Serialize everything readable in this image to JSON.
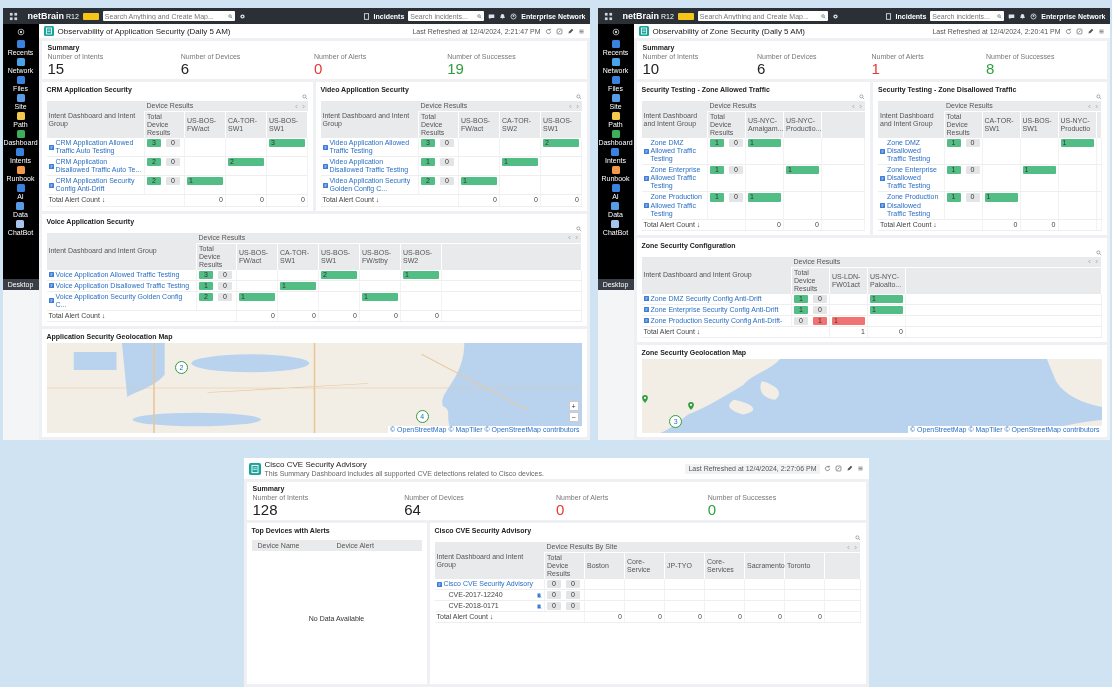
{
  "screens": [
    {
      "topbar": {
        "logo": "netBrain",
        "version": "R12",
        "search_placeholder": "Search Anything and Create Map...",
        "incidents_label": "Incidents",
        "incidents_placeholder": "Search incidents...",
        "network": "Enterprise Network"
      },
      "sidebar": {
        "items": [
          {
            "label": "Recents",
            "color": "#3b82e0"
          },
          {
            "label": "Network",
            "color": "#4aa3e8"
          },
          {
            "label": "Files",
            "color": "#3b82e0"
          },
          {
            "label": "Site",
            "color": "#5a9be6"
          },
          {
            "label": "Path",
            "color": "#f2c94c"
          },
          {
            "label": "Dashboard",
            "color": "#3fae5a"
          },
          {
            "label": "Intents",
            "color": "#3b82e0"
          },
          {
            "label": "Runbook",
            "color": "#f29a4a"
          },
          {
            "label": "AI",
            "color": "#3b82e0"
          },
          {
            "label": "Data",
            "color": "#5a9be6"
          },
          {
            "label": "ChatBot",
            "color": "#a9c4ea"
          }
        ],
        "footer": "Desktop"
      },
      "dashboard": {
        "title": "Observability of Application Security (Daily 5 AM)",
        "refreshed": "Last Refreshed at 12/4/2024, 2:21:47 PM",
        "summary": {
          "title": "Summary",
          "stats": [
            {
              "label": "Number of Intents",
              "value": "15",
              "color": "#222222"
            },
            {
              "label": "Number of Devices",
              "value": "6",
              "color": "#222222"
            },
            {
              "label": "Number of Alerts",
              "value": "0",
              "color": "#e53935"
            },
            {
              "label": "Number of Successes",
              "value": "19",
              "color": "#2e9e3e"
            }
          ]
        },
        "widget_rows": [
          {
            "widgets": [
              {
                "kind": "table",
                "title": "CRM Application Security",
                "group_header": "Intent Dashboard and Intent Group",
                "results_header": "Device Results",
                "total_header": "Total Device Results",
                "columns": [
                  "US-BOS-FW/act",
                  "CA-TOR-SW1",
                  "US-BOS-SW1"
                ],
                "rows": [
                  {
                    "name": "CRM Application Allowed Traffic Auto Testing",
                    "results": [
                      {
                        "value": "3",
                        "color": "#52bd84"
                      },
                      {
                        "value": "0",
                        "color": "#e3e4e6"
                      }
                    ],
                    "cells": [
                      null,
                      null,
                      {
                        "value": "3",
                        "color": "#52bd84"
                      }
                    ]
                  },
                  {
                    "name": "CRM Application Disallowed Traffic Auto Te...",
                    "results": [
                      {
                        "value": "2",
                        "color": "#52bd84"
                      },
                      {
                        "value": "0",
                        "color": "#e3e4e6"
                      }
                    ],
                    "cells": [
                      null,
                      {
                        "value": "2",
                        "color": "#52bd84"
                      },
                      null
                    ]
                  },
                  {
                    "name": "CRM Application Security Config Anti-Drift",
                    "results": [
                      {
                        "value": "2",
                        "color": "#52bd84"
                      },
                      {
                        "value": "0",
                        "color": "#e3e4e6"
                      }
                    ],
                    "cells": [
                      {
                        "value": "1",
                        "color": "#52bd84"
                      },
                      null,
                      null
                    ]
                  }
                ],
                "total_label": "Total Alert Count ↓",
                "totals": [
                  "0",
                  "0",
                  "0"
                ]
              },
              {
                "kind": "table",
                "title": "Video Application Security",
                "group_header": "Intent Dashboard and Intent Group",
                "results_header": "Device Results",
                "total_header": "Total Device Results",
                "columns": [
                  "US-BOS-FW/act",
                  "CA-TOR-SW2",
                  "US-BOS-SW1"
                ],
                "rows": [
                  {
                    "name": "Video Application Allowed Traffic Testing",
                    "results": [
                      {
                        "value": "3",
                        "color": "#52bd84"
                      },
                      {
                        "value": "0",
                        "color": "#e3e4e6"
                      }
                    ],
                    "cells": [
                      null,
                      null,
                      {
                        "value": "2",
                        "color": "#52bd84"
                      }
                    ]
                  },
                  {
                    "name": "Video Application Disallowed Traffic Testing",
                    "results": [
                      {
                        "value": "1",
                        "color": "#52bd84"
                      },
                      {
                        "value": "0",
                        "color": "#e3e4e6"
                      }
                    ],
                    "cells": [
                      null,
                      {
                        "value": "1",
                        "color": "#52bd84"
                      },
                      null
                    ]
                  },
                  {
                    "name": "Video Application Security Golden Config C...",
                    "results": [
                      {
                        "value": "2",
                        "color": "#52bd84"
                      },
                      {
                        "value": "0",
                        "color": "#e3e4e6"
                      }
                    ],
                    "cells": [
                      {
                        "value": "1",
                        "color": "#52bd84"
                      },
                      null,
                      null
                    ]
                  }
                ],
                "total_label": "Total Alert Count ↓",
                "totals": [
                  "0",
                  "0",
                  "0"
                ]
              }
            ]
          },
          {
            "widgets": [
              {
                "kind": "table",
                "title": "Voice Application Security",
                "group_header": "Intent Dashboard and Intent Group",
                "results_header": "Device Results",
                "total_header": "Total Device Results",
                "columns": [
                  "US-BOS-FW/act",
                  "CA-TOR-SW1",
                  "US-BOS-SW1",
                  "US-BOS-FW/stby",
                  "US-BOS-SW2"
                ],
                "rows": [
                  {
                    "name": "Voice Application Allowed Traffic Testing",
                    "results": [
                      {
                        "value": "3",
                        "color": "#52bd84"
                      },
                      {
                        "value": "0",
                        "color": "#e3e4e6"
                      }
                    ],
                    "cells": [
                      null,
                      null,
                      {
                        "value": "2",
                        "color": "#52bd84"
                      },
                      null,
                      {
                        "value": "1",
                        "color": "#52bd84"
                      }
                    ]
                  },
                  {
                    "name": "Voice Application Disallowed Traffic Testing",
                    "results": [
                      {
                        "value": "1",
                        "color": "#52bd84"
                      },
                      {
                        "value": "0",
                        "color": "#e3e4e6"
                      }
                    ],
                    "cells": [
                      null,
                      {
                        "value": "1",
                        "color": "#52bd84"
                      },
                      null,
                      null,
                      null
                    ]
                  },
                  {
                    "name": "Voice Application Security Golden Config C...",
                    "results": [
                      {
                        "value": "2",
                        "color": "#52bd84"
                      },
                      {
                        "value": "0",
                        "color": "#e3e4e6"
                      }
                    ],
                    "cells": [
                      {
                        "value": "1",
                        "color": "#52bd84"
                      },
                      null,
                      null,
                      {
                        "value": "1",
                        "color": "#52bd84"
                      },
                      null
                    ]
                  }
                ],
                "total_label": "Total Alert Count ↓",
                "totals": [
                  "0",
                  "0",
                  "0",
                  "0",
                  "0"
                ]
              }
            ]
          },
          {
            "widgets": [
              {
                "kind": "lake_map",
                "title": "Application Security Geolocation Map",
                "markers": [
                  {
                    "kind": "cluster",
                    "count": "2"
                  },
                  {
                    "kind": "cluster",
                    "count": "4"
                  }
                ],
                "zoom_controls": [
                  "+",
                  "−"
                ],
                "attribution": "© OpenStreetMap © MapTiler © OpenStreetMap contributors"
              }
            ]
          }
        ]
      }
    },
    {
      "topbar": {
        "logo": "netBrain",
        "version": "R12",
        "search_placeholder": "Search Anything and Create Map...",
        "incidents_label": "Incidents",
        "incidents_placeholder": "Search incidents...",
        "network": "Enterprise Network"
      },
      "sidebar": {
        "items": [
          {
            "label": "Recents",
            "color": "#3b82e0"
          },
          {
            "label": "Network",
            "color": "#4aa3e8"
          },
          {
            "label": "Files",
            "color": "#3b82e0"
          },
          {
            "label": "Site",
            "color": "#5a9be6"
          },
          {
            "label": "Path",
            "color": "#f2c94c"
          },
          {
            "label": "Dashboard",
            "color": "#3fae5a"
          },
          {
            "label": "Intents",
            "color": "#3b82e0"
          },
          {
            "label": "Runbook",
            "color": "#f29a4a"
          },
          {
            "label": "AI",
            "color": "#3b82e0"
          },
          {
            "label": "Data",
            "color": "#5a9be6"
          },
          {
            "label": "ChatBot",
            "color": "#a9c4ea"
          }
        ],
        "footer": "Desktop"
      },
      "dashboard": {
        "title": "Observability of Zone Security (Daily 5 AM)",
        "refreshed": "Last Refreshed at 12/4/2024, 2:20:41 PM",
        "summary": {
          "title": "Summary",
          "stats": [
            {
              "label": "Number of Intents",
              "value": "10",
              "color": "#222222"
            },
            {
              "label": "Number of Devices",
              "value": "6",
              "color": "#222222"
            },
            {
              "label": "Number of Alerts",
              "value": "1",
              "color": "#e53935"
            },
            {
              "label": "Number of Successes",
              "value": "8",
              "color": "#2e9e3e"
            }
          ]
        },
        "widget_rows": [
          {
            "widgets": [
              {
                "kind": "table",
                "title": "Security Testing - Zone Allowed Traffic",
                "group_header": "Intent Dashboard and Intent Group",
                "results_header": "Device Results",
                "total_header": "Total Device Results",
                "columns": [
                  "US-NYC-Amalgam...",
                  "US-NYC-Productio..."
                ],
                "rows": [
                  {
                    "name": "Zone DMZ Allowed Traffic Testing",
                    "results": [
                      {
                        "value": "1",
                        "color": "#52bd84"
                      },
                      {
                        "value": "0",
                        "color": "#e3e4e6"
                      }
                    ],
                    "cells": [
                      {
                        "value": "1",
                        "color": "#52bd84"
                      },
                      null
                    ]
                  },
                  {
                    "name": "Zone Enterprise Allowed Traffic Testing",
                    "results": [
                      {
                        "value": "1",
                        "color": "#52bd84"
                      },
                      {
                        "value": "0",
                        "color": "#e3e4e6"
                      }
                    ],
                    "cells": [
                      null,
                      {
                        "value": "1",
                        "color": "#52bd84"
                      }
                    ]
                  },
                  {
                    "name": "Zone Production Allowed Traffic Testing",
                    "results": [
                      {
                        "value": "1",
                        "color": "#52bd84"
                      },
                      {
                        "value": "0",
                        "color": "#e3e4e6"
                      }
                    ],
                    "cells": [
                      {
                        "value": "1",
                        "color": "#52bd84"
                      },
                      null
                    ]
                  }
                ],
                "total_label": "Total Alert Count ↓",
                "totals": [
                  "0",
                  "0"
                ]
              },
              {
                "kind": "table",
                "title": "Security Testing - Zone Disallowed Traffic",
                "group_header": "Intent Dashboard and Intent Group",
                "results_header": "Device Results",
                "total_header": "Total Device Results",
                "columns": [
                  "CA-TOR-SW1",
                  "US-BOS-SW1",
                  "US-NYC-Productio"
                ],
                "rows": [
                  {
                    "name": "Zone DMZ Disallowed Traffic Testing",
                    "results": [
                      {
                        "value": "1",
                        "color": "#52bd84"
                      },
                      {
                        "value": "0",
                        "color": "#e3e4e6"
                      }
                    ],
                    "cells": [
                      null,
                      null,
                      {
                        "value": "1",
                        "color": "#52bd84"
                      }
                    ]
                  },
                  {
                    "name": "Zone Enterprise Disallowed Traffic Testing",
                    "results": [
                      {
                        "value": "1",
                        "color": "#52bd84"
                      },
                      {
                        "value": "0",
                        "color": "#e3e4e6"
                      }
                    ],
                    "cells": [
                      null,
                      {
                        "value": "1",
                        "color": "#52bd84"
                      },
                      null
                    ]
                  },
                  {
                    "name": "Zone Production Disallowed Traffic Testing",
                    "results": [
                      {
                        "value": "1",
                        "color": "#52bd84"
                      },
                      {
                        "value": "0",
                        "color": "#e3e4e6"
                      }
                    ],
                    "cells": [
                      {
                        "value": "1",
                        "color": "#52bd84"
                      },
                      null,
                      null
                    ]
                  }
                ],
                "total_label": "Total Alert Count ↓",
                "totals": [
                  "0",
                  "0"
                ]
              }
            ]
          },
          {
            "widgets": [
              {
                "kind": "table",
                "title": "Zone Security Configuration",
                "group_header": "Intent Dashboard and Intent Group",
                "results_header": "Device Results",
                "total_header": "Total Device Results",
                "columns": [
                  "US-LDN-FW01act",
                  "US-NYC-Paloalto..."
                ],
                "rows": [
                  {
                    "name": "Zone DMZ Security Config Anti-Drift",
                    "results": [
                      {
                        "value": "1",
                        "color": "#52bd84"
                      },
                      {
                        "value": "0",
                        "color": "#e3e4e6"
                      }
                    ],
                    "cells": [
                      null,
                      {
                        "value": "1",
                        "color": "#52bd84"
                      }
                    ]
                  },
                  {
                    "name": "Zone Enterprise Security Config Anti-Drift",
                    "results": [
                      {
                        "value": "1",
                        "color": "#52bd84"
                      },
                      {
                        "value": "0",
                        "color": "#e3e4e6"
                      }
                    ],
                    "cells": [
                      null,
                      {
                        "value": "1",
                        "color": "#52bd84"
                      }
                    ]
                  },
                  {
                    "name": "Zone Production Security Config Anti-Drift-",
                    "results": [
                      {
                        "value": "0",
                        "color": "#e3e4e6"
                      },
                      {
                        "value": "1",
                        "color": "#f07272"
                      }
                    ],
                    "cells": [
                      {
                        "value": "1",
                        "color": "#f07272"
                      },
                      null
                    ]
                  }
                ],
                "total_label": "Total Alert Count ↓",
                "totals": [
                  "1",
                  "0"
                ]
              }
            ]
          },
          {
            "widgets": [
              {
                "kind": "coast_map",
                "title": "Zone Security Geolocation Map",
                "markers": [
                  {
                    "kind": "pin"
                  },
                  {
                    "kind": "pin"
                  },
                  {
                    "kind": "cluster",
                    "count": "3"
                  }
                ],
                "attribution": "© OpenStreetMap © MapTiler © OpenStreetMap contributors"
              }
            ]
          }
        ]
      }
    },
    {
      "dashboard": {
        "title": "Cisco CVE Security Advisory",
        "subtitle": "This Summary Dashboard includes all supported CVE detections related to Cisco devices.",
        "refreshed": "Last Refreshed at 12/4/2024, 2:27:06 PM",
        "summary": {
          "title": "Summary",
          "stats": [
            {
              "label": "Number of Intents",
              "value": "128",
              "color": "#222222"
            },
            {
              "label": "Number of Devices",
              "value": "64",
              "color": "#222222"
            },
            {
              "label": "Number of Alerts",
              "value": "0",
              "color": "#e53935"
            },
            {
              "label": "Number of Successes",
              "value": "0",
              "color": "#2e9e3e"
            }
          ]
        },
        "widget_rows": [
          {
            "widgets": [
              {
                "kind": "device_list",
                "title": "Top Devices with Alerts",
                "columns": [
                  "Device Name",
                  "Device Alert"
                ],
                "empty_text": "No Data Available"
              },
              {
                "kind": "table",
                "title": "Cisco CVE Security Advisory",
                "group_header": "Intent Dashboard and Intent Group",
                "results_header": "Device Results By Site",
                "total_header": "Total Device Results",
                "columns": [
                  "Boston",
                  "Core-Service",
                  "JP-TYO",
                  "Core-Services",
                  "Sacramento",
                  "Toronto"
                ],
                "rows": [
                  {
                    "name": "Cisco CVE Security Advisory",
                    "results": [
                      {
                        "value": "0",
                        "color": "#e3e4e6"
                      },
                      {
                        "value": "0",
                        "color": "#e3e4e6"
                      }
                    ],
                    "cells": [
                      null,
                      null,
                      null,
                      null,
                      null,
                      null
                    ],
                    "children": [
                      {
                        "name": "CVE-2017-12240",
                        "results": [
                          {
                            "value": "0",
                            "color": "#e3e4e6"
                          },
                          {
                            "value": "0",
                            "color": "#e3e4e6"
                          }
                        ],
                        "cells": [
                          null,
                          null,
                          null,
                          null,
                          null,
                          null
                        ]
                      },
                      {
                        "name": "CVE-2018-0171",
                        "results": [
                          {
                            "value": "0",
                            "color": "#e3e4e6"
                          },
                          {
                            "value": "0",
                            "color": "#e3e4e6"
                          }
                        ],
                        "cells": [
                          null,
                          null,
                          null,
                          null,
                          null,
                          null
                        ]
                      }
                    ]
                  }
                ],
                "total_label": "Total Alert Count ↓",
                "totals": [
                  "0",
                  "0",
                  "0",
                  "0",
                  "0",
                  "0"
                ]
              }
            ]
          }
        ]
      }
    }
  ]
}
